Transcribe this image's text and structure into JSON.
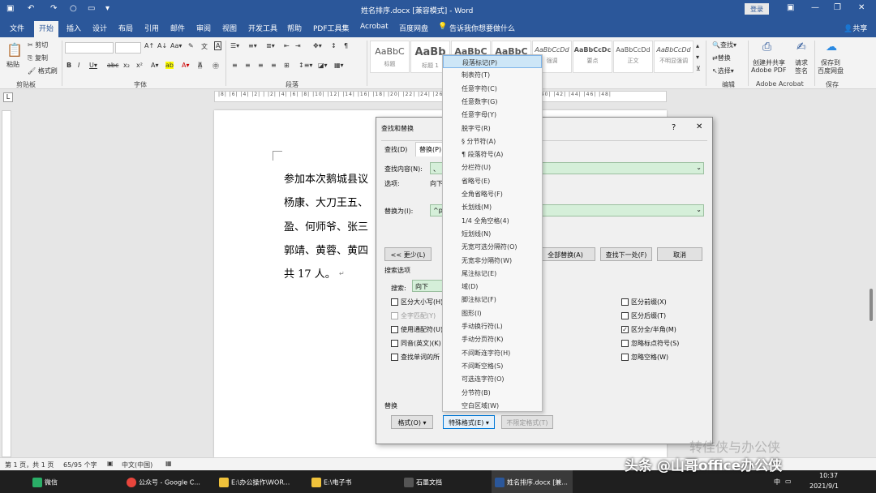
{
  "title": "姓名排序.docx [兼容模式] - Word",
  "login_label": "登录",
  "share_label": "共享",
  "tabs": [
    "文件",
    "开始",
    "插入",
    "设计",
    "布局",
    "引用",
    "邮件",
    "审阅",
    "视图",
    "开发工具",
    "帮助",
    "PDF工具集",
    "Acrobat",
    "百度网盘"
  ],
  "tell_me": "告诉我你想要做什么",
  "clipboard": {
    "paste": "粘贴",
    "cut": "剪切",
    "copy": "复制",
    "painter": "格式刷",
    "group": "剪贴板"
  },
  "font_group": "字体",
  "paragraph_group": "段落",
  "styles": [
    {
      "preview": "AaBbC",
      "name": "标题"
    },
    {
      "preview": "AaBb",
      "name": "标题 1"
    },
    {
      "preview": "AaBbC",
      "name": ""
    },
    {
      "preview": "AaBbC",
      "name": ""
    },
    {
      "preview": "AaBbCcDd",
      "name": "强调"
    },
    {
      "preview": "AaBbCcDc",
      "name": "要点"
    },
    {
      "preview": "AaBbCcDd",
      "name": "正文"
    },
    {
      "preview": "AaBbCcDd",
      "name": "不明显强调"
    }
  ],
  "editing": {
    "find": "查找",
    "replace": "替换",
    "select": "选择",
    "group": "编辑"
  },
  "adobe": {
    "create": "创建并共享",
    "create2": "Adobe PDF",
    "request": "请求",
    "request2": "签名",
    "group": "Adobe Acrobat"
  },
  "baidu": {
    "save": "保存到",
    "save2": "百度网盘",
    "group": "保存"
  },
  "ruler_text": "|8| |6| |4| |2| | |2| |4| |6| |8| |10| |12| |14| |16| |18| |20| |22| |24| |26| |28| |30| |32| |34| |36| |38| |40| |42| |44| |46| |48|",
  "doc_lines": [
    "参加本次鹅城县议",
    "杨康、大刀王五、",
    "盈、何师爷、张三",
    "郭靖、黄蓉、黄四",
    "共 17 人。"
  ],
  "dialog": {
    "title": "查找和替换",
    "help": "?",
    "close": "✕",
    "tab_find": "查找(D)",
    "tab_replace": "替换(P)",
    "find_label": "查找内容(N):",
    "find_value": "、",
    "options_label": "选项:",
    "options_value": "向下",
    "replace_label": "替换为(I):",
    "replace_value": "^p",
    "less_button": "<< 更少(L)",
    "replace_all": "全部替换(A)",
    "find_next": "查找下一处(F)",
    "cancel": "取消",
    "search_options": "搜索选项",
    "search_label": "搜索:",
    "search_value": "向下",
    "left_checks": [
      {
        "label": "区分大小写(H)",
        "checked": false
      },
      {
        "label": "全字匹配(Y)",
        "checked": false,
        "disabled": true
      },
      {
        "label": "使用通配符(U)",
        "checked": false
      },
      {
        "label": "同音(英文)(K)",
        "checked": false
      },
      {
        "label": "查找单词的所",
        "checked": false
      }
    ],
    "right_checks": [
      {
        "label": "区分前缀(X)",
        "checked": false
      },
      {
        "label": "区分后缀(T)",
        "checked": false
      },
      {
        "label": "区分全/半角(M)",
        "checked": true
      },
      {
        "label": "忽略标点符号(S)",
        "checked": false
      },
      {
        "label": "忽略空格(W)",
        "checked": false
      }
    ],
    "replace_section": "替换",
    "format_button": "格式(O) ▾",
    "special_button": "特殊格式(E) ▾",
    "no_format_button": "不限定格式(T)"
  },
  "special_menu": [
    "段落标记(P)",
    "制表符(T)",
    "任意字符(C)",
    "任意数字(G)",
    "任意字母(Y)",
    "脱字号(R)",
    "§ 分节符(A)",
    "¶ 段落符号(A)",
    "分栏符(U)",
    "省略号(E)",
    "全角省略号(F)",
    "长划线(M)",
    "1/4 全角空格(4)",
    "短划线(N)",
    "无宽可选分隔符(O)",
    "无宽非分隔符(W)",
    "尾注标记(E)",
    "域(D)",
    "脚注标记(F)",
    "图形(I)",
    "手动换行符(L)",
    "手动分页符(K)",
    "不间断连字符(H)",
    "不间断空格(S)",
    "可选连字符(O)",
    "分节符(B)",
    "空白区域(W)"
  ],
  "status": {
    "page": "第 1 页，共 1 页",
    "words": "65/95 个字",
    "lang": "中文(中国)"
  },
  "taskbar": [
    {
      "label": "微信",
      "color": "#2aae67"
    },
    {
      "label": "公众号 - Google C...",
      "color": "#e8453c"
    },
    {
      "label": "E:\\办公操作\\WOR...",
      "color": "#f0c23b"
    },
    {
      "label": "E:\\电子书",
      "color": "#f0c23b"
    },
    {
      "label": "石墨文档",
      "color": "#555555"
    },
    {
      "label": "姓名排序.docx [兼...",
      "color": "#2b579a"
    }
  ],
  "clock": {
    "time": "10:37",
    "date": "2021/9/1"
  },
  "tray_lang": "中",
  "watermark": "头条 @山哥office办公侠",
  "watermark2": "转佳侠与办公侠"
}
